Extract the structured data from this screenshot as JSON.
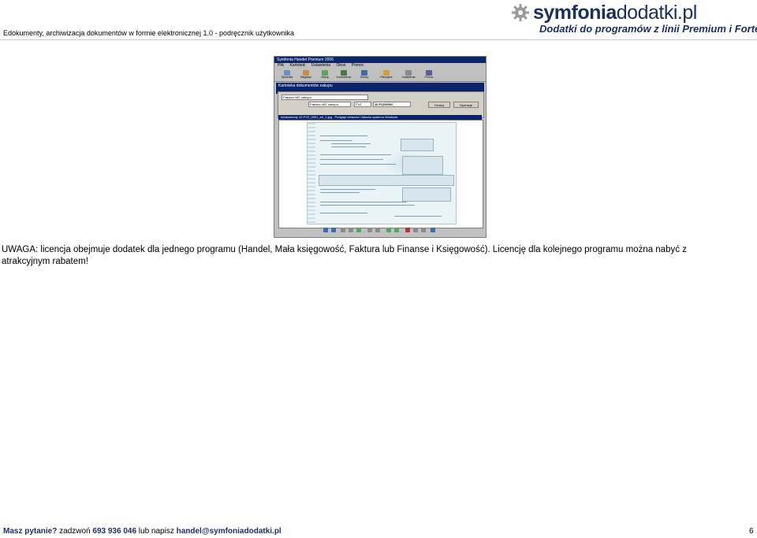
{
  "header": {
    "doc_title": "Edokumenty, archiwizacja dokumentów w formie elektronicznej 1.0  - podręcznik użytkownika",
    "logo_main": "symfonia",
    "logo_accent": "dodatki.pl",
    "logo_sub": "Dodatki do programów z linii Premium i Forte"
  },
  "screenshot": {
    "window_title": "Symfonia Handel Premium 2006",
    "menu": [
      "Plik",
      "Kartoteki",
      "Ustawienia",
      "Okno",
      "Pomoc"
    ],
    "toolbar": [
      "Sprzedaż",
      "Magazyn",
      "Zakup",
      "Kontrahenci",
      "Towary",
      "Pieniądze",
      "Ustawienia",
      "Pomoc"
    ],
    "subwindow_title": "Kartoteka dokumentów zakupu",
    "form_title": "Faktura VAT zakupu",
    "doc_number": "10 FVZ/0001",
    "doc_type": "FVZ",
    "btn_print": "Drukuj",
    "btn_ops": "Operacje",
    "viewer_title": "edokumenty 10-FVZ_0001_str_1.jpg - Podgląd obrazów i faksów systemu Windows"
  },
  "notice": "UWAGA: licencja obejmuje dodatek dla jednego programu (Handel, Mała księgowość, Faktura lub Finanse i Księgowość). Licencję dla kolejnego programu można nabyć z atrakcyjnym rabatem!",
  "footer": {
    "question": "Masz pytanie?",
    "call": "zadzwoń",
    "phone": "693 936 046",
    "or_write": "lub napisz",
    "email": "handel@symfoniadodatki.pl",
    "page": "6"
  },
  "colors": {
    "brand": "#1d2e5e",
    "window_title": "#0a246a"
  },
  "icons": [
    "gear-icon",
    "toolbar-icon"
  ]
}
